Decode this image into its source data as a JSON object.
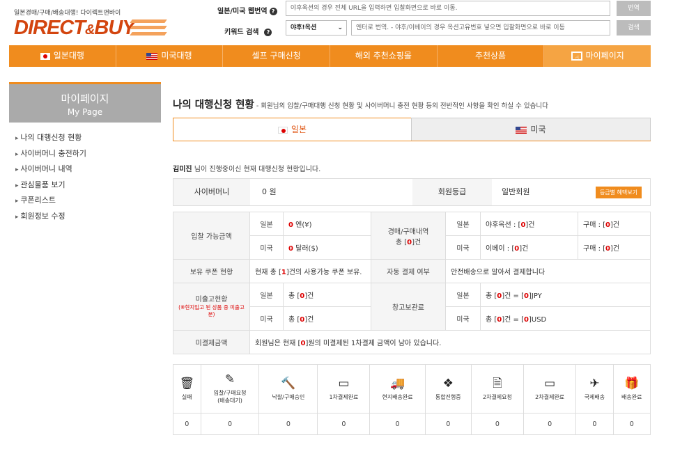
{
  "header": {
    "tagline": "일본경매/구매/배송대행! 다이렉트앤바이",
    "logo_main": "DIRECT",
    "logo_amp": "&",
    "logo_end": "BUY",
    "translate_label": "일본/미국 웹번역",
    "translate_placeholder": "야후옥션의 경우 전체 URL을 입력하면 입찰화면으로 바로 이동.",
    "translate_button": "번역",
    "keyword_label": "키워드 검색",
    "keyword_select": "야후!옥션",
    "keyword_placeholder": "엔터로 번역. - 야후/이베이의 경우 옥션고유번호 넣으면 입찰화면으로 바로 이동",
    "search_button": "검색"
  },
  "nav": [
    "일본대행",
    "미국대행",
    "셀프 구매신청",
    "해외 추천쇼핑몰",
    "추천상품",
    "마이페이지"
  ],
  "sidebar": {
    "title": "마이페이지",
    "subtitle": "My Page",
    "items": [
      "나의 대행신청 현황",
      "사이버머니 충전하기",
      "사이버머니 내역",
      "관심물품 보기",
      "쿠폰리스트",
      "회원정보 수정"
    ]
  },
  "main": {
    "title": "나의 대행신청 현황",
    "title_sep": " - ",
    "description": "회원님의 입찰/구매대행 신청 현황 및 사이버머니 충전 현황 등의 전반적인 사항을 확인 하실 수 있습니다",
    "tab_japan": "일본",
    "tab_usa": "미국",
    "user_name": "김미진",
    "user_suffix": " 님이 진행중이신 현재 대행신청 현황입니다."
  },
  "info": {
    "cyber_money_label": "사이버머니",
    "cyber_money_value": "0 원",
    "grade_label": "회원등급",
    "grade_value": "일반회원",
    "grade_button": "등급별 혜택보기"
  },
  "summary": {
    "bid_label": "입찰 가능금액",
    "japan": "일본",
    "usa": "미국",
    "bid_jp_value": "0",
    "bid_jp_unit": " 엔(¥)",
    "bid_us_value": "0",
    "bid_us_unit": " 달러($)",
    "auction_label": "경매/구매내역",
    "auction_total_prefix": "총 [",
    "auction_total_value": "0",
    "auction_total_suffix": "]건",
    "yahoo_prefix": "야후옥션 : [",
    "yahoo_value": "0",
    "ebay_prefix": "이베이 : [",
    "ebay_value": "0",
    "bracket_suffix": "]건",
    "buy_prefix": "구매 : [",
    "buy_jp_value": "0",
    "buy_us_value": "0",
    "coupon_label": "보유 쿠폰 현황",
    "coupon_prefix": "현재 총 [",
    "coupon_value": "1",
    "coupon_suffix": "]건의 사용가능 쿠폰 보유.",
    "autopay_label": "자동 결제 여부",
    "autopay_value": "안전배송으로 알아서 결제합니다",
    "unshipped_label": "미출고현황",
    "unshipped_note": "(※현지입고 된 상품 중 미출고분)",
    "total_prefix": "총 [",
    "unshipped_jp_value": "0",
    "unshipped_us_value": "0",
    "storage_label": "창고보관료",
    "storage_jp_count": "0",
    "storage_jp_mid": "]건 = [",
    "storage_jp_amount": "0",
    "storage_jp_unit": "]JPY",
    "storage_us_count": "0",
    "storage_us_amount": "0",
    "storage_us_unit": "]USD",
    "unpaid_label": "미결제금액",
    "unpaid_prefix": "회원님은 현재 [",
    "unpaid_value": "0",
    "unpaid_suffix": "]원의 미결제된 1차결제 금액이 남아 있습니다."
  },
  "status": [
    {
      "icon": "trash-icon",
      "label": "실패",
      "count": "0"
    },
    {
      "icon": "edit-icon",
      "label": "입찰/구매요청\n(배송대기)",
      "count": "0"
    },
    {
      "icon": "gavel-icon",
      "label": "낙찰/구매승인",
      "count": "0"
    },
    {
      "icon": "card-icon",
      "label": "1차결제완료",
      "count": "0"
    },
    {
      "icon": "truck-icon",
      "label": "현지배송완료",
      "count": "0"
    },
    {
      "icon": "boxes-icon",
      "label": "통합진행중",
      "count": "0"
    },
    {
      "icon": "document-icon",
      "label": "2차결제요청",
      "count": "0"
    },
    {
      "icon": "card-icon",
      "label": "2차결제완료",
      "count": "0"
    },
    {
      "icon": "plane-icon",
      "label": "국제배송",
      "count": "0"
    },
    {
      "icon": "gift-icon",
      "label": "배송완료",
      "count": "0"
    }
  ]
}
